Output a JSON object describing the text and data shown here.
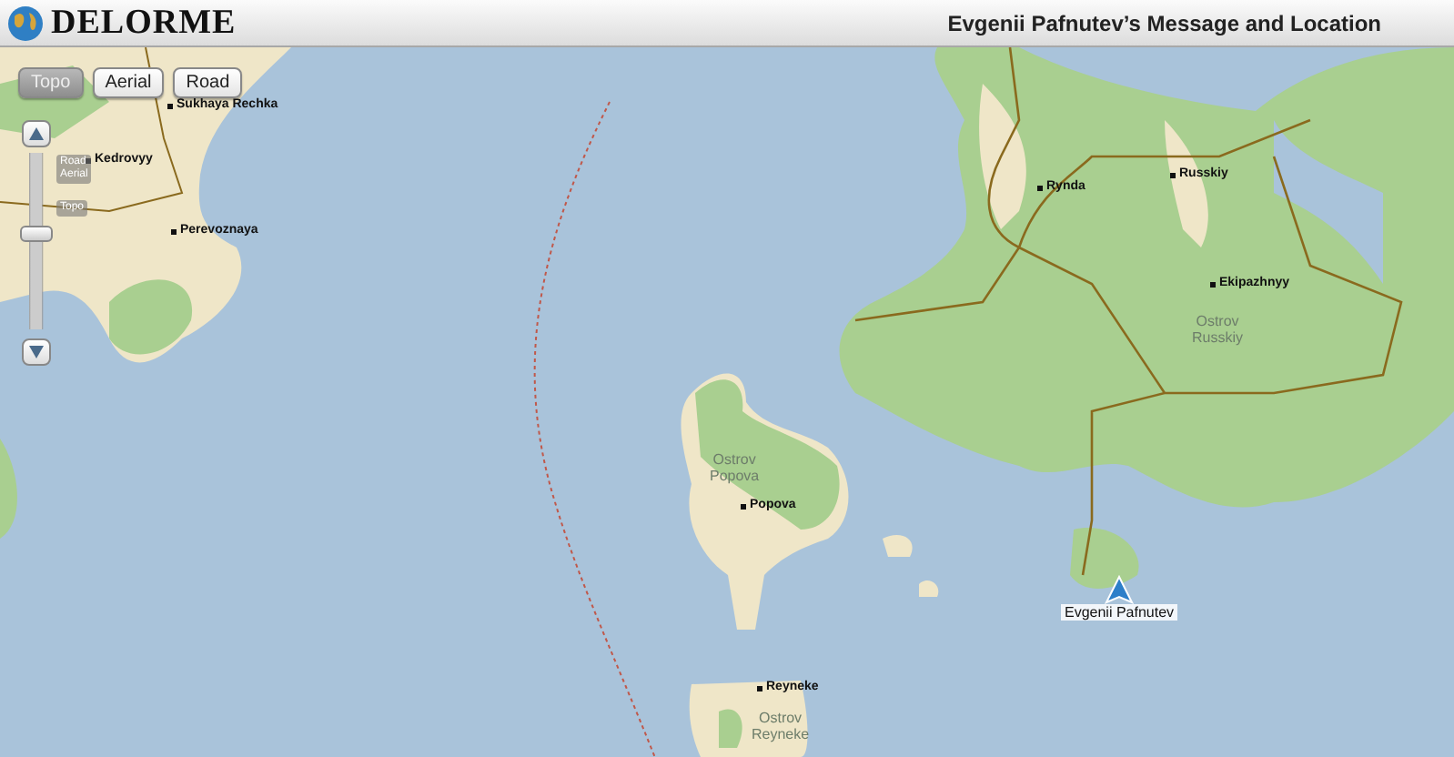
{
  "header": {
    "logo": "DELORME",
    "title": "Evgenii Pafnutev’s Message and Location"
  },
  "map_types": [
    {
      "label": "Topo",
      "selected": true
    },
    {
      "label": "Aerial",
      "selected": false
    },
    {
      "label": "Road",
      "selected": false
    }
  ],
  "zoom": {
    "level": 0.55,
    "labels": [
      "Road\nAerial",
      "Topo"
    ]
  },
  "places": [
    {
      "label": "Sukhaya Rechka",
      "kind": "town"
    },
    {
      "label": "Kedrovyy",
      "kind": "town"
    },
    {
      "label": "Perevoznaya",
      "kind": "town"
    },
    {
      "label": "Rynda",
      "kind": "town"
    },
    {
      "label": "Russkiy",
      "kind": "town"
    },
    {
      "label": "Ekipazhnyy",
      "kind": "town"
    },
    {
      "label": "Ostrov\nRusskiy",
      "kind": "island"
    },
    {
      "label": "Ostrov\nPopova",
      "kind": "island"
    },
    {
      "label": "Popova",
      "kind": "town"
    },
    {
      "label": "Reyneke",
      "kind": "town"
    },
    {
      "label": "Ostrov\nReyneke",
      "kind": "island"
    }
  ],
  "marker": {
    "label": "Evgenii Pafnutev"
  }
}
